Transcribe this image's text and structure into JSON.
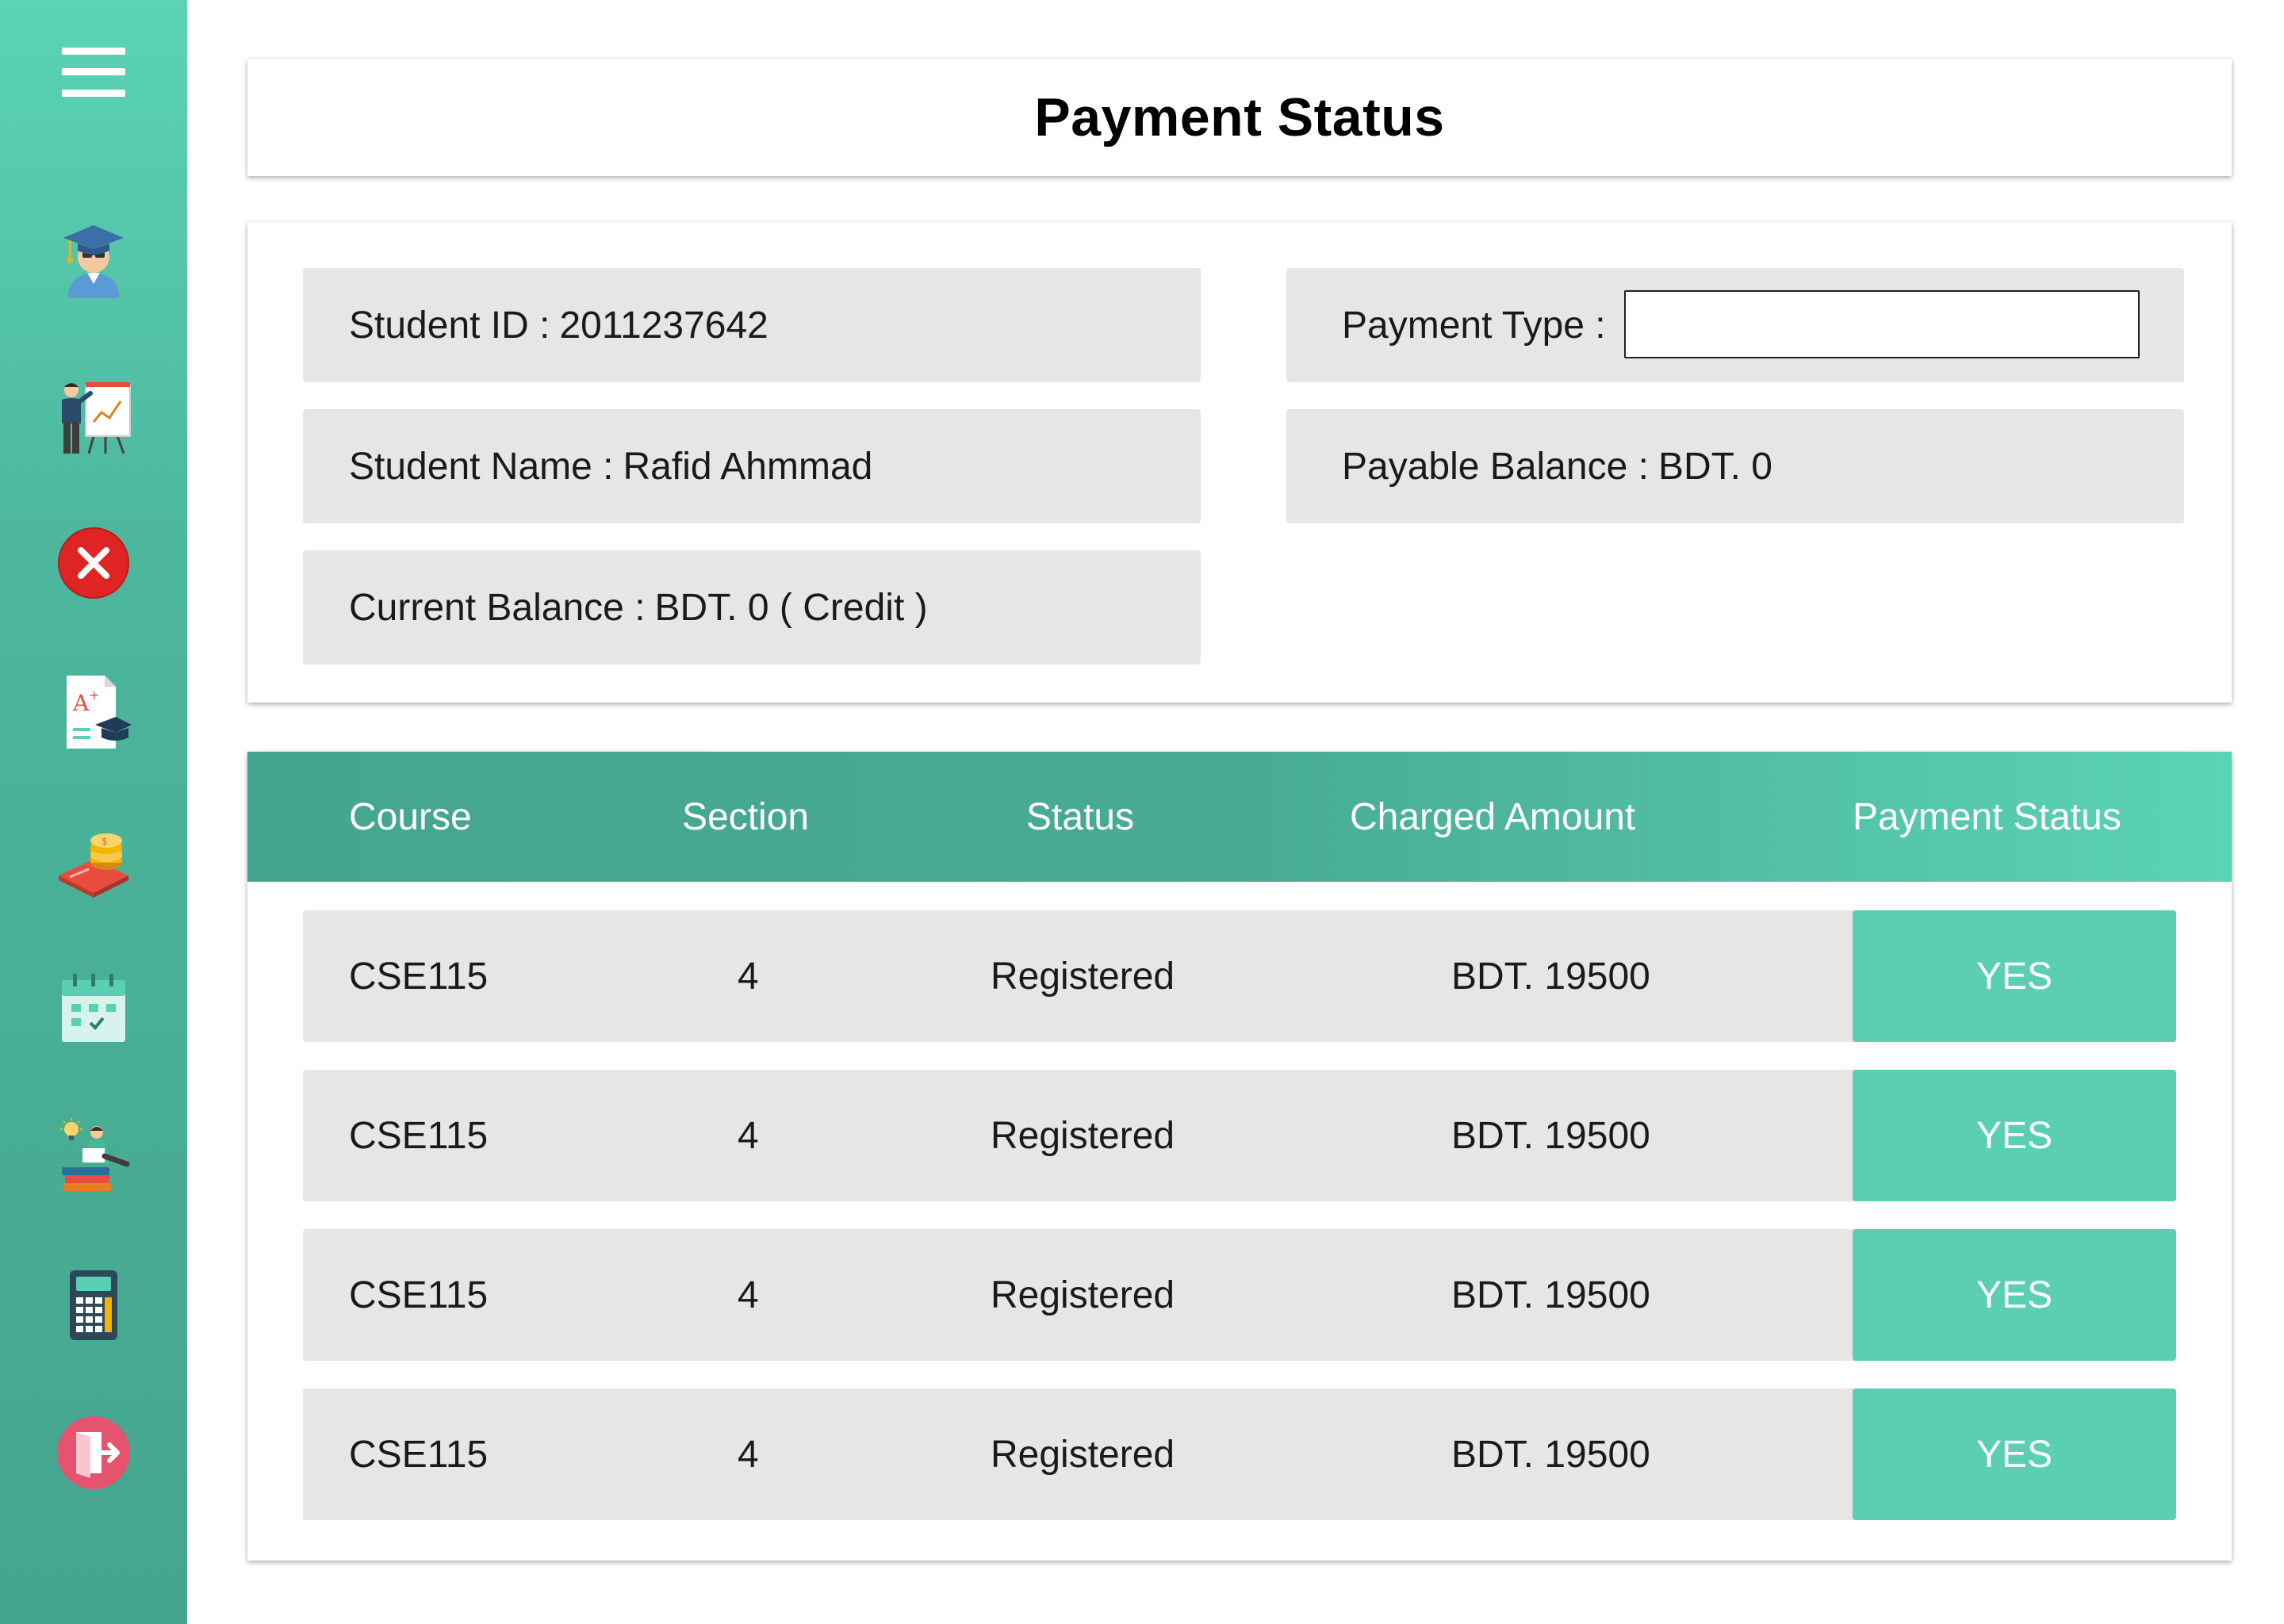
{
  "page": {
    "title": "Payment Status"
  },
  "sidebar": {
    "items": [
      {
        "name": "menu-icon"
      },
      {
        "name": "student-graduate-icon"
      },
      {
        "name": "teacher-presentation-icon"
      },
      {
        "name": "close-circle-icon"
      },
      {
        "name": "grade-report-icon"
      },
      {
        "name": "payment-coins-icon"
      },
      {
        "name": "calendar-icon"
      },
      {
        "name": "reading-student-icon"
      },
      {
        "name": "calculator-icon"
      },
      {
        "name": "logout-icon"
      }
    ]
  },
  "info": {
    "student_id_label": "Student ID :",
    "student_id": "2011237642",
    "student_name_label": "Student Name :",
    "student_name": "Rafid Ahmmad",
    "current_balance_label": "Current Balance :",
    "current_balance": "BDT. 0 ( Credit )",
    "payment_type_label": "Payment Type :",
    "payment_type_value": "",
    "payable_balance_label": "Payable Balance :",
    "payable_balance": "BDT. 0"
  },
  "table": {
    "headers": [
      "Course",
      "Section",
      "Status",
      "Charged Amount",
      "Payment Status"
    ],
    "rows": [
      {
        "course": "CSE115",
        "section": "4",
        "status": "Registered",
        "amount": "BDT. 19500",
        "payment": "YES"
      },
      {
        "course": "CSE115",
        "section": "4",
        "status": "Registered",
        "amount": "BDT. 19500",
        "payment": "YES"
      },
      {
        "course": "CSE115",
        "section": "4",
        "status": "Registered",
        "amount": "BDT. 19500",
        "payment": "YES"
      },
      {
        "course": "CSE115",
        "section": "4",
        "status": "Registered",
        "amount": "BDT. 19500",
        "payment": "YES"
      }
    ]
  },
  "colors": {
    "sidebar_top": "#5bd3b6",
    "sidebar_bottom": "#45a58f",
    "accent": "#5bcfb4",
    "row_bg": "#e6e6e6"
  }
}
